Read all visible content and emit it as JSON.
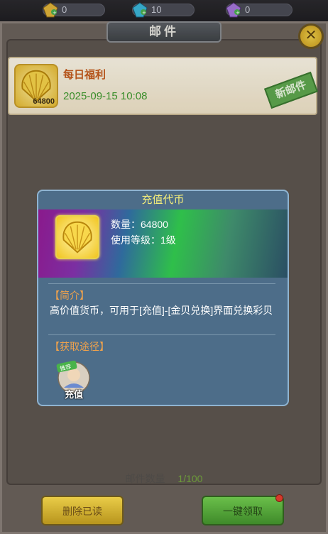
{
  "currency": [
    {
      "icon": "gold-gem-icon",
      "value": "0"
    },
    {
      "icon": "blue-gem-icon",
      "value": "10"
    },
    {
      "icon": "purple-gem-icon",
      "value": "0"
    }
  ],
  "panel": {
    "title": "邮件"
  },
  "mail": {
    "item_qty": "64800",
    "title": "每日福利",
    "date": "2025-09-15 10:08",
    "stamp": "新邮件"
  },
  "popup": {
    "title": "充值代币",
    "quantity": "数量：64800",
    "use_level": "使用等级：1级",
    "intro_label": "【简介】",
    "intro_text": "高价值货币，可用于[充值]-[金贝兑换]界面兑换彩贝",
    "source_label": "【获取途径】",
    "source_badge": "推荐",
    "source_name": "充值"
  },
  "footer": {
    "count_label": "邮件数量",
    "count_value": "1/100",
    "delete_read": "删除已读",
    "claim_all": "一键领取"
  },
  "colors": {
    "popup_bg": "#4d6d89",
    "title_text": "#f5ee7a",
    "orange_label": "#f0a24c",
    "mail_title": "#c45a1b",
    "mail_date": "#3f9a2e"
  }
}
